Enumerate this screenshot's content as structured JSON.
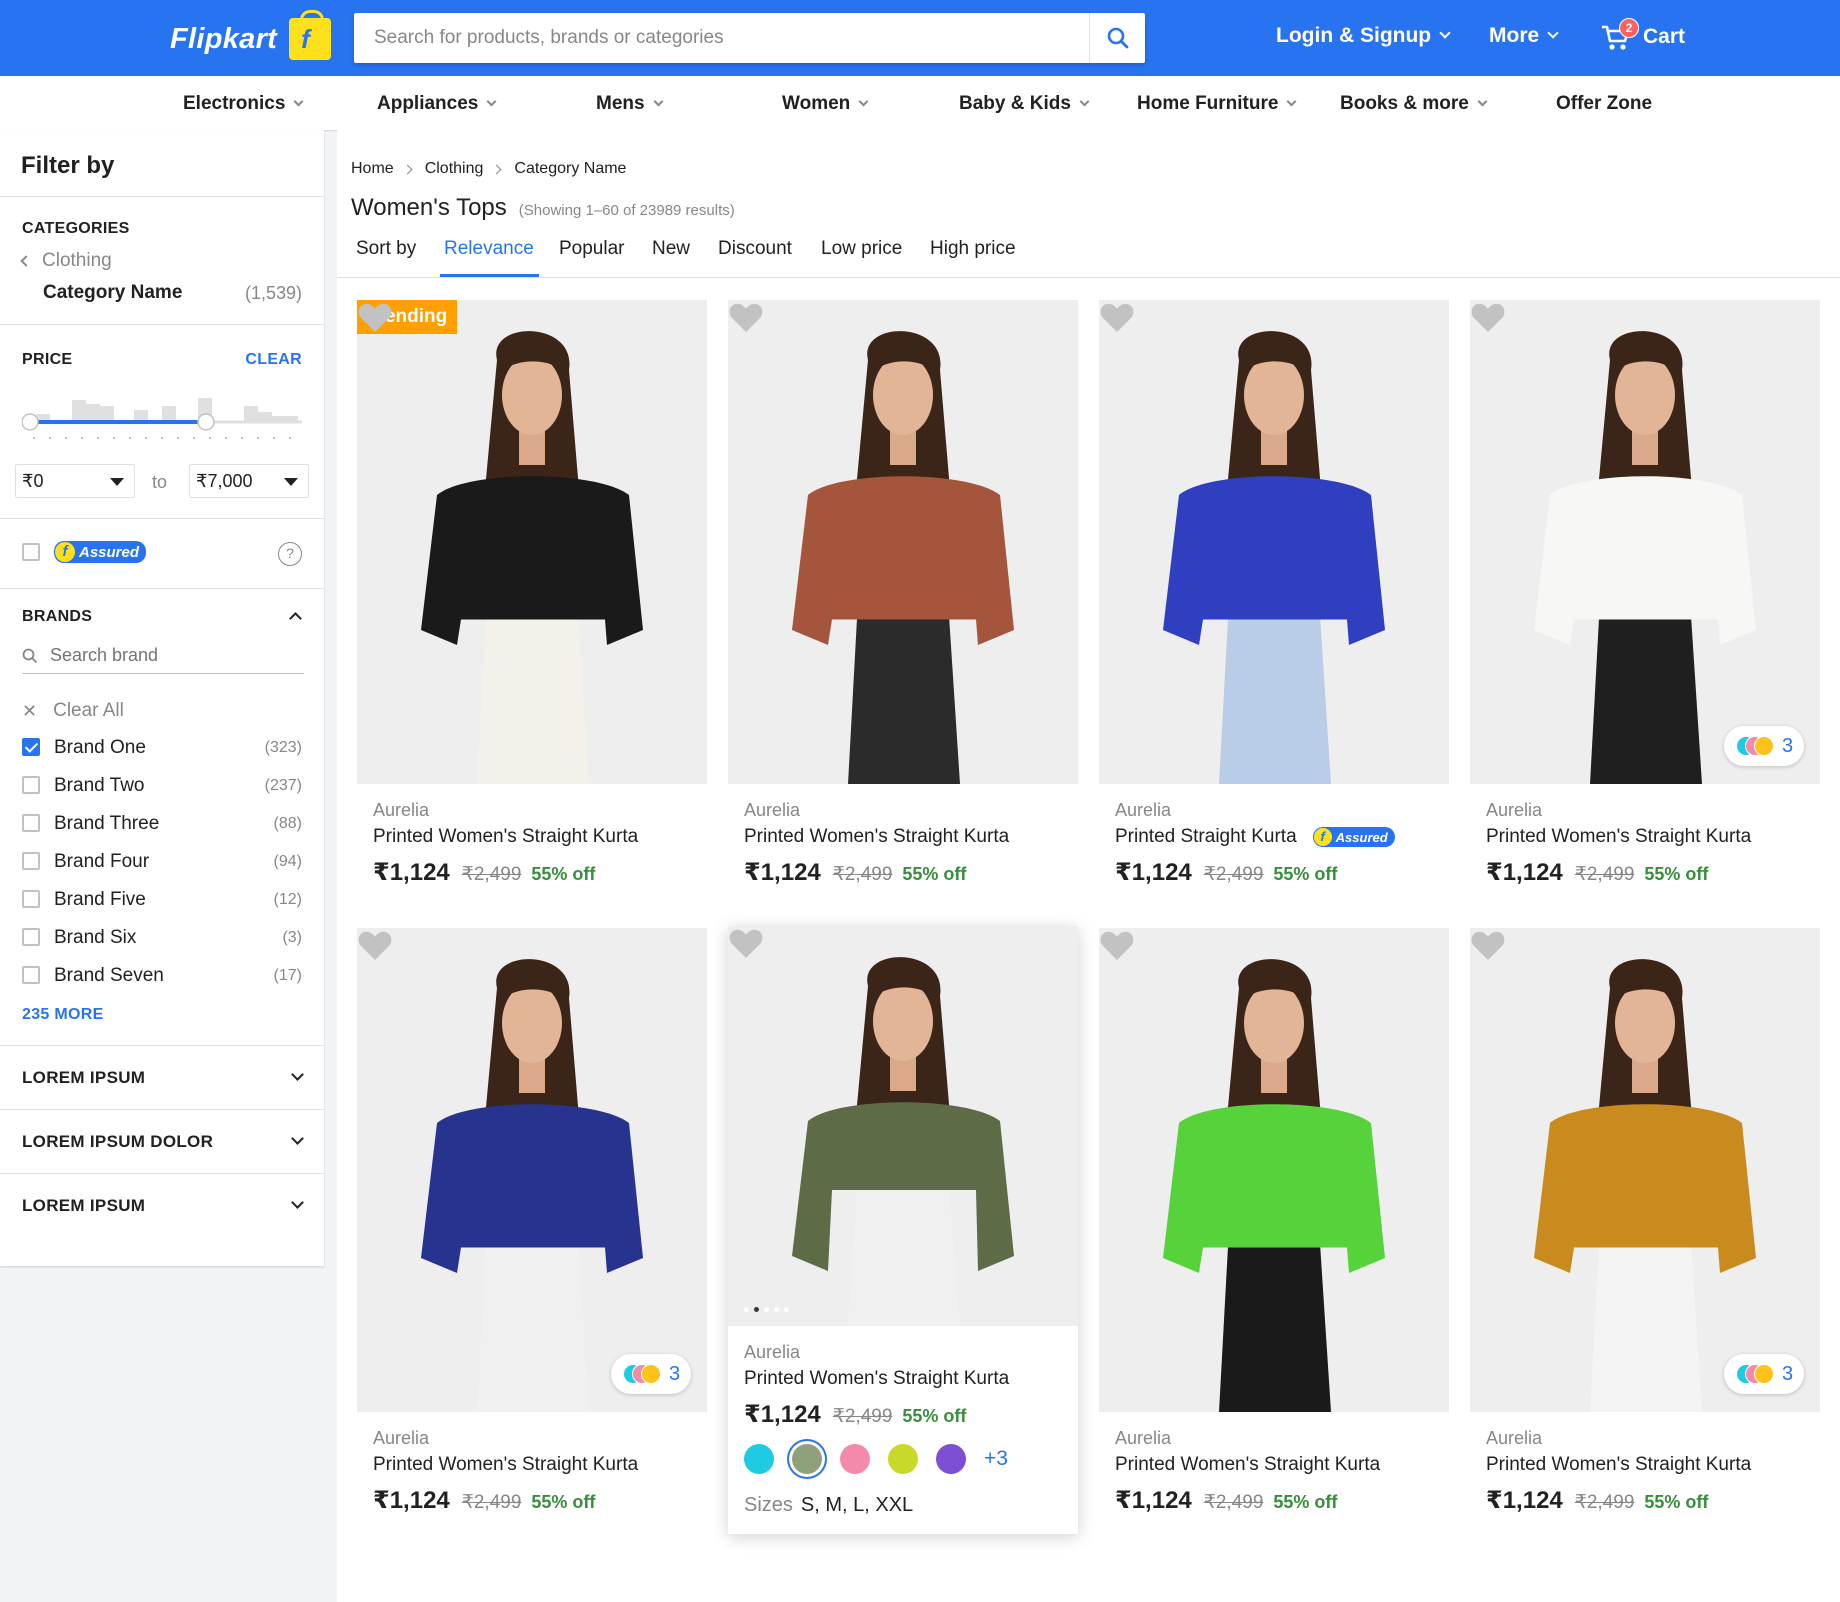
{
  "header": {
    "logo": "Flipkart",
    "logo_mark": "f",
    "search_placeholder": "Search for products, brands or categories",
    "login": "Login & Signup",
    "more": "More",
    "cart": "Cart",
    "cart_count": "2"
  },
  "nav": [
    "Electronics",
    "Appliances",
    "Mens",
    "Women",
    "Baby & Kids",
    "Home Furniture",
    "Books & more",
    "Offer Zone"
  ],
  "sidebar": {
    "title": "Filter by",
    "categories_head": "CATEGORIES",
    "parent_category": "Clothing",
    "category_name": "Category Name",
    "category_count": "(1,539)",
    "price_head": "PRICE",
    "clear": "CLEAR",
    "price_min": "₹0",
    "price_to": "to",
    "price_max": "₹7,000",
    "assured": "Assured",
    "assured_mark": "f",
    "help": "?",
    "brands_head": "BRANDS",
    "brand_search_placeholder": "Search brand",
    "clear_all": "Clear All",
    "brands": [
      {
        "name": "Brand One",
        "count": "(323)",
        "checked": true
      },
      {
        "name": "Brand Two",
        "count": "(237)",
        "checked": false
      },
      {
        "name": "Brand Three",
        "count": "(88)",
        "checked": false
      },
      {
        "name": "Brand Four",
        "count": "(94)",
        "checked": false
      },
      {
        "name": "Brand Five",
        "count": "(12)",
        "checked": false
      },
      {
        "name": "Brand Six",
        "count": "(3)",
        "checked": false
      },
      {
        "name": "Brand Seven",
        "count": "(17)",
        "checked": false
      }
    ],
    "more_brands": "235 MORE",
    "sections": [
      "LOREM IPSUM",
      "LOREM IPSUM DOLOR",
      "LOREM IPSUM"
    ]
  },
  "main": {
    "breadcrumb": [
      "Home",
      "Clothing",
      "Category Name"
    ],
    "title": "Women's Tops",
    "results": "(Showing 1–60 of 23989 results)",
    "sort_label": "Sort by",
    "sort_options": [
      "Relevance",
      "Popular",
      "New",
      "Discount",
      "Low price",
      "High price"
    ],
    "sort_active": "Relevance"
  },
  "products": [
    {
      "brand": "Aurelia",
      "name": "Printed Women's Straight Kurta",
      "price": "₹1,124",
      "mrp": "₹2,499",
      "off": "55% off",
      "badge": "Trending",
      "top_color": "#1a1a1a",
      "bottom_color": "#f4f1ea"
    },
    {
      "brand": "Aurelia",
      "name": "Printed Women's Straight Kurta",
      "price": "₹1,124",
      "mrp": "₹2,499",
      "off": "55% off",
      "top_color": "#a4553b",
      "bottom_color": "#2b2b2b"
    },
    {
      "brand": "Aurelia",
      "name": "Printed Straight Kurta",
      "price": "₹1,124",
      "mrp": "₹2,499",
      "off": "55% off",
      "assured": "Assured",
      "top_color": "#2f3fbf",
      "bottom_color": "#b9cde6"
    },
    {
      "brand": "Aurelia",
      "name": "Printed Women's Straight Kurta",
      "price": "₹1,124",
      "mrp": "₹2,499",
      "off": "55% off",
      "swatches": "3",
      "top_color": "#f7f7f5",
      "bottom_color": "#1f1f1f"
    },
    {
      "brand": "Aurelia",
      "name": "Printed Women's Straight Kurta",
      "price": "₹1,124",
      "mrp": "₹2,499",
      "off": "55% off",
      "swatches": "3",
      "top_color": "#26348f",
      "bottom_color": "#f0f0f0"
    },
    {
      "brand": "Aurelia",
      "name": "Printed Women's Straight Kurta",
      "price": "₹1,124",
      "mrp": "₹2,499",
      "off": "55% off",
      "top_color": "#5d6b47",
      "bottom_color": "#f0f0f0"
    },
    {
      "brand": "Aurelia",
      "name": "Printed Women's Straight Kurta",
      "price": "₹1,124",
      "mrp": "₹2,499",
      "off": "55% off",
      "top_color": "#56d23a",
      "bottom_color": "#1a1a1a"
    },
    {
      "brand": "Aurelia",
      "name": "Printed Women's Straight Kurta",
      "price": "₹1,124",
      "mrp": "₹2,499",
      "off": "55% off",
      "swatches": "3",
      "top_color": "#c98a1e",
      "bottom_color": "#f4f4f4"
    }
  ],
  "hover_card": {
    "colors": [
      "#1ecbe1",
      "#8fa07a",
      "#f48aa9",
      "#c9d92a",
      "#7e4fd4"
    ],
    "more_colors": "+3",
    "sizes_label": "Sizes",
    "sizes": "S, M, L, XXL"
  },
  "colors": {
    "brand_blue": "#2874f0",
    "logo_yellow": "#ffe11b",
    "discount_green": "#388e3c",
    "trending_orange": "#ff9f00"
  }
}
